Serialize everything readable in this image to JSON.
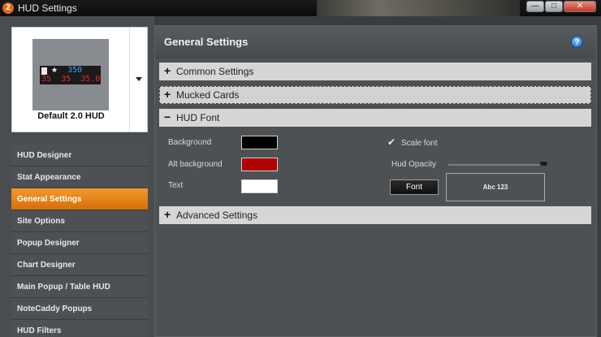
{
  "window": {
    "title": "HUD Settings",
    "logo_text": "2"
  },
  "window_controls": {
    "minimize": "—",
    "maximize": "□",
    "close": "✕"
  },
  "preview": {
    "hud_label": "Default 2.0 HUD",
    "hud_top_value": "350",
    "hud_bottom_values": "35  35  35.0",
    "star": "★"
  },
  "sidebar": {
    "items": [
      {
        "label": "HUD Designer"
      },
      {
        "label": "Stat Appearance"
      },
      {
        "label": "General Settings"
      },
      {
        "label": "Site Options"
      },
      {
        "label": "Popup Designer"
      },
      {
        "label": "Chart Designer"
      },
      {
        "label": "Main Popup / Table HUD"
      },
      {
        "label": "NoteCaddy Popups"
      },
      {
        "label": "HUD Filters"
      }
    ],
    "active_index": 2
  },
  "panel": {
    "title": "General Settings",
    "help_glyph": "?"
  },
  "sections": [
    {
      "sign": "+",
      "label": "Common Settings"
    },
    {
      "sign": "+",
      "label": "Mucked Cards"
    },
    {
      "sign": "−",
      "label": "HUD Font"
    },
    {
      "sign": "+",
      "label": "Advanced Settings"
    }
  ],
  "hud_font": {
    "background_label": "Background",
    "background_color": "#000000",
    "alt_background_label": "Alt background",
    "alt_background_color": "#b00000",
    "text_label": "Text",
    "text_color": "#ffffff",
    "scale_font_label": "Scale font",
    "scale_font_check": "✔",
    "hud_opacity_label": "Hud Opacity",
    "hud_opacity_value": 1.0,
    "font_button_label": "Font",
    "sample_text": "Abc 123"
  },
  "colors": {
    "accent": "#e8820f",
    "panel_bg": "#4e5154",
    "section_bg": "#d6d6d6"
  }
}
